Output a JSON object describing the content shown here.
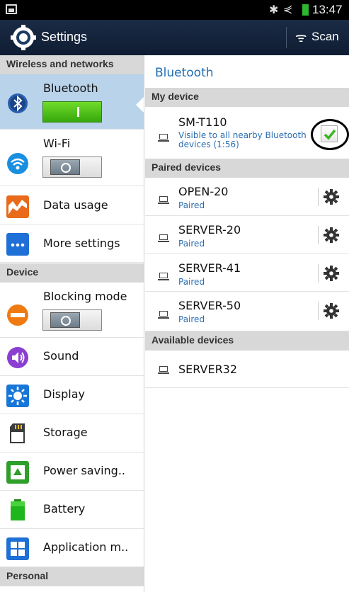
{
  "status_bar": {
    "time": "13:47"
  },
  "action_bar": {
    "title": "Settings",
    "scan_label": "Scan"
  },
  "left_panel": {
    "sections": {
      "wireless": "Wireless and networks",
      "device": "Device",
      "personal": "Personal"
    },
    "items": [
      {
        "label": "Bluetooth",
        "toggle": "on",
        "selected": true
      },
      {
        "label": "Wi-Fi",
        "toggle": "off"
      },
      {
        "label": "Data usage"
      },
      {
        "label": "More settings"
      },
      {
        "label": "Blocking mode",
        "toggle": "off"
      },
      {
        "label": "Sound"
      },
      {
        "label": "Display"
      },
      {
        "label": "Storage"
      },
      {
        "label": "Power saving.."
      },
      {
        "label": "Battery"
      },
      {
        "label": "Application m.."
      }
    ]
  },
  "right_panel": {
    "title": "Bluetooth",
    "my_device": {
      "header": "My device",
      "name": "SM-T110",
      "status_line1": "Visible to all nearby Bluetooth",
      "status_line2": "devices (1:56)",
      "visible_checked": true
    },
    "paired": {
      "header": "Paired devices",
      "devices": [
        {
          "name": "OPEN-20",
          "status": "Paired"
        },
        {
          "name": "SERVER-20",
          "status": "Paired"
        },
        {
          "name": "SERVER-41",
          "status": "Paired"
        },
        {
          "name": "SERVER-50",
          "status": "Paired"
        }
      ]
    },
    "available": {
      "header": "Available devices",
      "devices": [
        {
          "name": "SERVER32"
        }
      ]
    }
  },
  "colors": {
    "action_bar": "#14233b",
    "selected_item": "#b9d3ea",
    "accent_blue": "#1f6eb5",
    "toggle_on": "#4cc41a"
  }
}
